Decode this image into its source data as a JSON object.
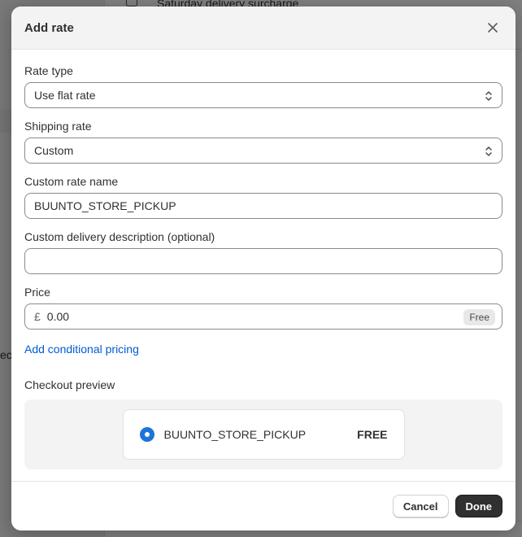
{
  "background": {
    "surcharge_text": "Saturday delivery surcharge",
    "side_fragment": "ect"
  },
  "modal": {
    "title": "Add rate",
    "close_icon": "close-icon",
    "rate_type": {
      "label": "Rate type",
      "value": "Use flat rate"
    },
    "shipping_rate": {
      "label": "Shipping rate",
      "value": "Custom"
    },
    "custom_rate_name": {
      "label": "Custom rate name",
      "value": "BUUNTO_STORE_PICKUP"
    },
    "delivery_description": {
      "label": "Custom delivery description (optional)",
      "value": ""
    },
    "price": {
      "label": "Price",
      "currency": "£",
      "value": "0.00",
      "badge": "Free"
    },
    "conditional_link": "Add conditional pricing",
    "checkout_preview": {
      "label": "Checkout preview",
      "name": "BUUNTO_STORE_PICKUP",
      "price": "FREE"
    },
    "footer": {
      "cancel": "Cancel",
      "done": "Done"
    }
  },
  "colors": {
    "link": "#005bd3",
    "radio": "#1c74d9",
    "primary_button": "#303030"
  }
}
